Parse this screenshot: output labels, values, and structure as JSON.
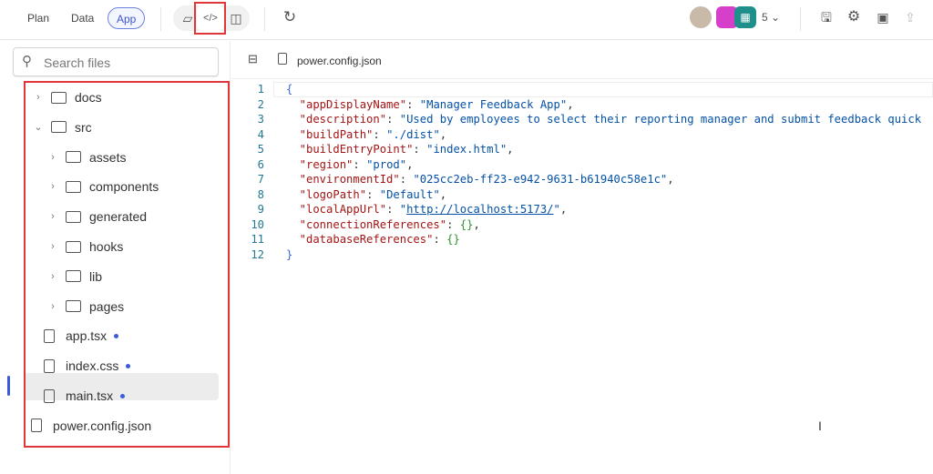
{
  "header": {
    "tabs": [
      {
        "label": "Plan"
      },
      {
        "label": "Data"
      },
      {
        "label": "App",
        "active": true
      }
    ],
    "view_icons": [
      "note-icon",
      "code-icon",
      "preview-icon"
    ],
    "refresh_icon": "refresh-icon",
    "collaborator_count": "5",
    "actions": [
      "save-icon",
      "settings-icon",
      "publish-icon",
      "share-icon"
    ]
  },
  "sidebar": {
    "search_placeholder": "Search files",
    "items": [
      {
        "label": "docs",
        "type": "folder",
        "expanded": false,
        "level": 0
      },
      {
        "label": "src",
        "type": "folder",
        "expanded": true,
        "level": 0
      },
      {
        "label": "assets",
        "type": "folder",
        "expanded": false,
        "level": 1
      },
      {
        "label": "components",
        "type": "folder",
        "expanded": false,
        "level": 1
      },
      {
        "label": "generated",
        "type": "folder",
        "expanded": false,
        "level": 1
      },
      {
        "label": "hooks",
        "type": "folder",
        "expanded": false,
        "level": 1
      },
      {
        "label": "lib",
        "type": "folder",
        "expanded": false,
        "level": 1
      },
      {
        "label": "pages",
        "type": "folder",
        "expanded": false,
        "level": 1
      },
      {
        "label": "app.tsx",
        "type": "file",
        "modified": true,
        "level": 1
      },
      {
        "label": "index.css",
        "type": "file",
        "modified": true,
        "level": 1
      },
      {
        "label": "main.tsx",
        "type": "file",
        "modified": true,
        "level": 1
      },
      {
        "label": "power.config.json",
        "type": "file",
        "selected": true,
        "level": 0
      }
    ]
  },
  "editor": {
    "filename": "power.config.json",
    "lines": [
      {
        "n": "1",
        "parts": [
          [
            "b",
            "{"
          ]
        ]
      },
      {
        "n": "2",
        "parts": [
          [
            "k",
            "  \"appDisplayName\""
          ],
          [
            "p",
            ": "
          ],
          [
            "v",
            "\"Manager Feedback App\""
          ],
          [
            "p",
            ","
          ]
        ]
      },
      {
        "n": "3",
        "parts": [
          [
            "k",
            "  \"description\""
          ],
          [
            "p",
            ": "
          ],
          [
            "v",
            "\"Used by employees to select their reporting manager and submit feedback quick"
          ]
        ]
      },
      {
        "n": "4",
        "parts": [
          [
            "k",
            "  \"buildPath\""
          ],
          [
            "p",
            ": "
          ],
          [
            "v",
            "\"./dist\""
          ],
          [
            "p",
            ","
          ]
        ]
      },
      {
        "n": "5",
        "parts": [
          [
            "k",
            "  \"buildEntryPoint\""
          ],
          [
            "p",
            ": "
          ],
          [
            "v",
            "\"index.html\""
          ],
          [
            "p",
            ","
          ]
        ]
      },
      {
        "n": "6",
        "parts": [
          [
            "k",
            "  \"region\""
          ],
          [
            "p",
            ": "
          ],
          [
            "v",
            "\"prod\""
          ],
          [
            "p",
            ","
          ]
        ]
      },
      {
        "n": "7",
        "parts": [
          [
            "k",
            "  \"environmentId\""
          ],
          [
            "p",
            ": "
          ],
          [
            "v",
            "\"025cc2eb-ff23-e942-9631-b61940c58e1c\""
          ],
          [
            "p",
            ","
          ]
        ]
      },
      {
        "n": "8",
        "parts": [
          [
            "k",
            "  \"logoPath\""
          ],
          [
            "p",
            ": "
          ],
          [
            "v",
            "\"Default\""
          ],
          [
            "p",
            ","
          ]
        ]
      },
      {
        "n": "9",
        "parts": [
          [
            "k",
            "  \"localAppUrl\""
          ],
          [
            "p",
            ": "
          ],
          [
            "v",
            "\""
          ],
          [
            "url",
            "http://localhost:5173/"
          ],
          [
            "v",
            "\""
          ],
          [
            "p",
            ","
          ]
        ]
      },
      {
        "n": "10",
        "parts": [
          [
            "k",
            "  \"connectionReferences\""
          ],
          [
            "p",
            ": "
          ],
          [
            "g",
            "{}"
          ],
          [
            "p",
            ","
          ]
        ]
      },
      {
        "n": "11",
        "parts": [
          [
            "k",
            "  \"databaseReferences\""
          ],
          [
            "p",
            ": "
          ],
          [
            "g",
            "{}"
          ]
        ]
      },
      {
        "n": "12",
        "parts": [
          [
            "b",
            "}"
          ]
        ]
      }
    ]
  },
  "colors": {
    "accent": "#3b5bdb",
    "annotation": "#e0363a",
    "json_key": "#a31515",
    "json_value": "#0451a5"
  }
}
